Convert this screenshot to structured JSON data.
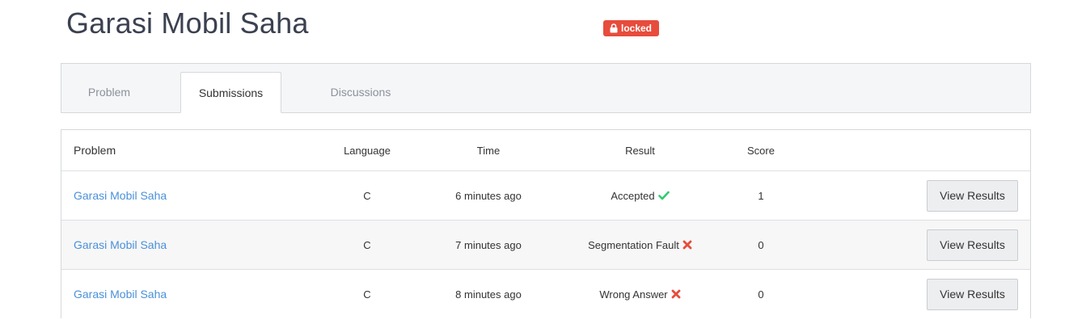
{
  "page": {
    "title": "Garasi Mobil Saha",
    "badge": {
      "label": "locked",
      "color": "#e74c3c",
      "icon": "lock-icon"
    }
  },
  "tabs": [
    {
      "label": "Problem",
      "active": false
    },
    {
      "label": "Submissions",
      "active": true
    },
    {
      "label": "Discussions",
      "active": false
    }
  ],
  "table": {
    "headers": {
      "problem": "Problem",
      "language": "Language",
      "time": "Time",
      "result": "Result",
      "score": "Score"
    },
    "rows": [
      {
        "problem": "Garasi Mobil Saha",
        "language": "C",
        "time": "6 minutes ago",
        "result": "Accepted",
        "result_icon": "check-icon",
        "score": "1",
        "action": "View Results"
      },
      {
        "problem": "Garasi Mobil Saha",
        "language": "C",
        "time": "7 minutes ago",
        "result": "Segmentation Fault",
        "result_icon": "cross-icon",
        "score": "0",
        "action": "View Results"
      },
      {
        "problem": "Garasi Mobil Saha",
        "language": "C",
        "time": "8 minutes ago",
        "result": "Wrong Answer",
        "result_icon": "cross-icon",
        "score": "0",
        "action": "View Results"
      }
    ]
  },
  "colors": {
    "link": "#4a90d9",
    "accepted": "#2ecc71",
    "rejected": "#e74c3c"
  }
}
